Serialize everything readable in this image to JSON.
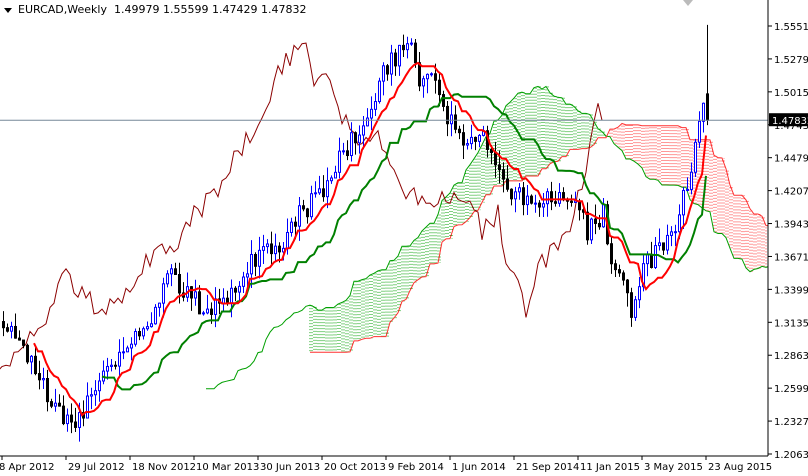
{
  "header": {
    "symbol": "EURCAD,Weekly",
    "open": "1.49979",
    "high": "1.55599",
    "low": "1.47429",
    "close": "1.47832"
  },
  "chart_data": {
    "type": "candlestick",
    "title": "EURCAD,Weekly",
    "indicator": "Ichimoku Kinko Hyo (9,26,52)",
    "current_price": "1.47832",
    "y_ticks": [
      "1.55510",
      "1.52790",
      "1.50150",
      "1.47430",
      "1.44790",
      "1.42070",
      "1.39430",
      "1.36710",
      "1.33990",
      "1.31350",
      "1.28630",
      "1.25990",
      "1.23270",
      "1.20630"
    ],
    "x_ticks": [
      "8 Apr 2012",
      "29 Jul 2012",
      "18 Nov 2012",
      "10 Mar 2013",
      "30 Jun 2013",
      "20 Oct 2013",
      "9 Feb 2014",
      "1 Jun 2014",
      "21 Sep 2014",
      "11 Jan 2015",
      "3 May 2015",
      "23 Aug 2015"
    ],
    "ylim": [
      1.2063,
      1.5551
    ],
    "close_keypoints_week_price": [
      [
        0,
        1.307
      ],
      [
        5,
        1.295
      ],
      [
        12,
        1.25
      ],
      [
        15,
        1.234
      ],
      [
        18,
        1.226
      ],
      [
        22,
        1.258
      ],
      [
        27,
        1.283
      ],
      [
        32,
        1.299
      ],
      [
        37,
        1.315
      ],
      [
        41,
        1.356
      ],
      [
        45,
        1.34
      ],
      [
        50,
        1.324
      ],
      [
        55,
        1.332
      ],
      [
        60,
        1.356
      ],
      [
        65,
        1.373
      ],
      [
        70,
        1.381
      ],
      [
        75,
        1.405
      ],
      [
        80,
        1.421
      ],
      [
        85,
        1.454
      ],
      [
        89,
        1.47
      ],
      [
        92,
        1.495
      ],
      [
        97,
        1.527
      ],
      [
        101,
        1.544
      ],
      [
        104,
        1.515
      ],
      [
        106,
        1.523
      ],
      [
        109,
        1.495
      ],
      [
        112,
        1.474
      ],
      [
        116,
        1.454
      ],
      [
        120,
        1.462
      ],
      [
        124,
        1.434
      ],
      [
        128,
        1.413
      ],
      [
        131,
        1.417
      ],
      [
        135,
        1.413
      ],
      [
        139,
        1.421
      ],
      [
        142,
        1.413
      ],
      [
        146,
        1.389
      ],
      [
        150,
        1.401
      ],
      [
        152,
        1.356
      ],
      [
        155,
        1.348
      ],
      [
        157,
        1.324
      ],
      [
        160,
        1.356
      ],
      [
        164,
        1.373
      ],
      [
        167,
        1.381
      ],
      [
        170,
        1.413
      ],
      [
        172,
        1.438
      ],
      [
        175,
        1.49979
      ],
      [
        176,
        1.47832
      ]
    ],
    "colors": {
      "bull": "#0000ff",
      "bear": "#000000",
      "tenkan": "#ff0000",
      "kijun": "#008000",
      "chikou": "#8b0000",
      "cloud_up": "#00a000",
      "cloud_down": "#ff3030"
    }
  }
}
